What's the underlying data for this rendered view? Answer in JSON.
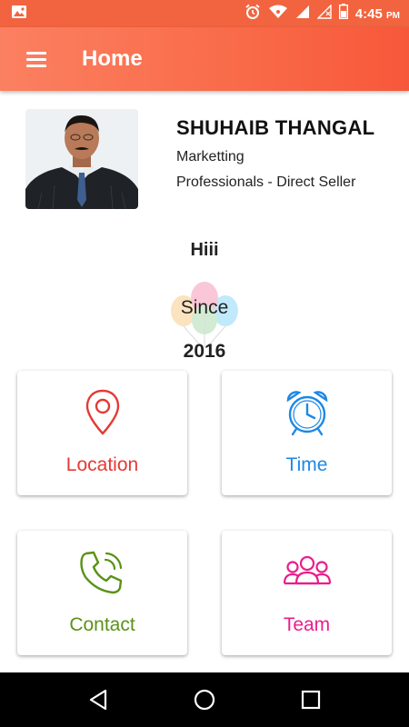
{
  "status_bar": {
    "time": "4:45",
    "ampm": "PM"
  },
  "app_bar": {
    "title": "Home"
  },
  "profile": {
    "name": "SHUHAIB THANGAL",
    "role": "Marketting",
    "company": "Professionals - Direct Seller"
  },
  "greeting": "Hiii",
  "since": {
    "label": "Since",
    "year": "2016"
  },
  "cards": [
    {
      "label": "Location",
      "icon": "map-pin-icon",
      "color": "#e53935"
    },
    {
      "label": "Time",
      "icon": "alarm-clock-icon",
      "color": "#1e88e5"
    },
    {
      "label": "Contact",
      "icon": "phone-ringing-icon",
      "color": "#5a9216"
    },
    {
      "label": "Team",
      "icon": "team-group-icon",
      "color": "#e91e8c"
    }
  ],
  "colors": {
    "status_bar": "#f2643f",
    "app_bar_start": "#fb8061",
    "app_bar_end": "#f7583a",
    "nav_bar": "#000000"
  }
}
